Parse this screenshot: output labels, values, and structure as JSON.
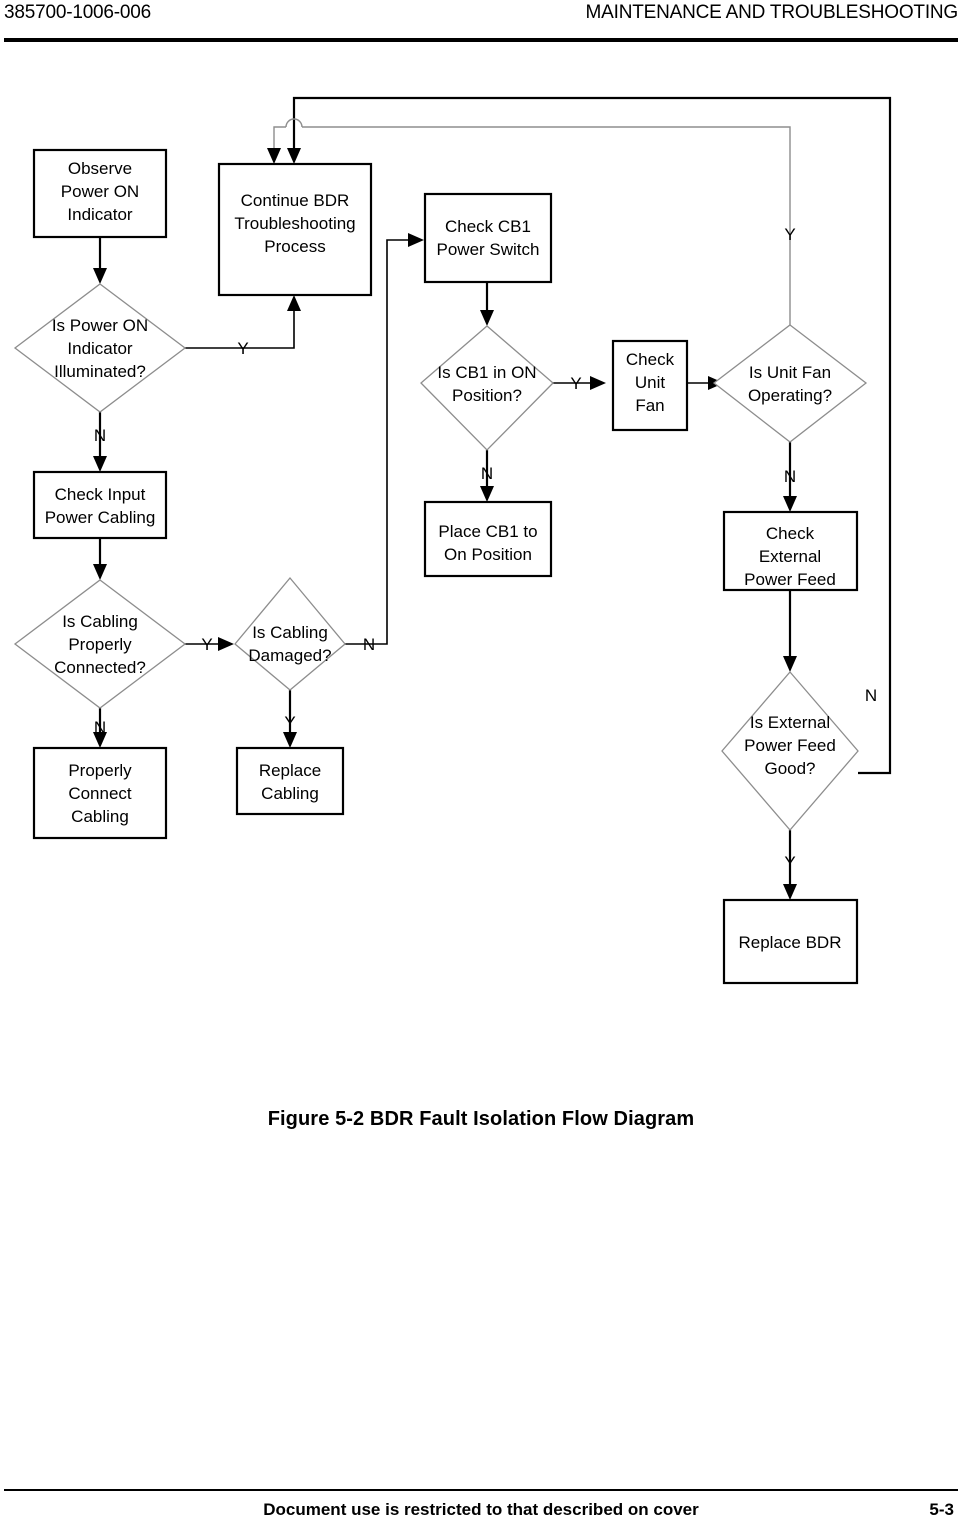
{
  "header": {
    "doc_id": "385700-1006-006",
    "title": "MAINTENANCE AND TROUBLESHOOTING"
  },
  "footer": {
    "notice": "Document use is restricted to that described on cover",
    "page_number": "5-3"
  },
  "figure": {
    "caption": "Figure 5-2  BDR Fault Isolation Flow Diagram"
  },
  "flowchart": {
    "nodes": {
      "observe_power_on": {
        "type": "process",
        "lines": [
          "Observe",
          "Power ON",
          "Indicator"
        ]
      },
      "continue_bdr": {
        "type": "process",
        "lines": [
          "Continue BDR",
          "Troubleshooting",
          "Process"
        ]
      },
      "check_cb1": {
        "type": "process",
        "lines": [
          "Check CB1",
          "Power Switch"
        ]
      },
      "is_power_on_illuminated": {
        "type": "decision",
        "lines": [
          "Is Power ON",
          "Indicator",
          "Illuminated?"
        ]
      },
      "is_cb1_on": {
        "type": "decision",
        "lines": [
          "Is CB1 in ON",
          "Position?"
        ]
      },
      "check_unit_fan": {
        "type": "process",
        "lines": [
          "Check",
          "Unit",
          "Fan"
        ]
      },
      "is_unit_fan_operating": {
        "type": "decision",
        "lines": [
          "Is Unit Fan",
          "Operating?"
        ]
      },
      "check_input_power_cabling": {
        "type": "process",
        "lines": [
          "Check Input",
          "Power Cabling"
        ]
      },
      "place_cb1_on": {
        "type": "process",
        "lines": [
          "Place CB1  to",
          "On Position"
        ]
      },
      "check_external_power_feed": {
        "type": "process",
        "lines": [
          "Check",
          "External",
          "Power Feed"
        ]
      },
      "is_cabling_connected": {
        "type": "decision",
        "lines": [
          "Is Cabling",
          "Properly",
          "Connected?"
        ]
      },
      "is_cabling_damaged": {
        "type": "decision",
        "lines": [
          "Is Cabling",
          "Damaged?"
        ]
      },
      "is_external_power_feed_good": {
        "type": "decision",
        "lines": [
          "Is External",
          "Power Feed",
          "Good?"
        ]
      },
      "properly_connect_cabling": {
        "type": "process",
        "lines": [
          "Properly",
          "Connect",
          "Cabling"
        ]
      },
      "replace_cabling": {
        "type": "process",
        "lines": [
          "Replace",
          "Cabling"
        ]
      },
      "replace_bdr": {
        "type": "process",
        "lines": [
          "Replace BDR"
        ]
      }
    },
    "edge_labels": {
      "power_on_yes": "Y",
      "power_on_no": "N",
      "cabling_connected_no": "N",
      "cabling_connected_yes": "Y",
      "cabling_damaged_yes": "Y",
      "cabling_damaged_no": "N",
      "cb1_on_yes": "Y",
      "cb1_on_no": "N",
      "unit_fan_yes": "Y",
      "unit_fan_no": "N",
      "external_feed_yes": "Y",
      "external_feed_no": "N"
    },
    "colors": {
      "box_stroke": "#000000",
      "diamond_stroke": "#8d8d8d",
      "background": "#ffffff",
      "text": "#000000"
    }
  }
}
